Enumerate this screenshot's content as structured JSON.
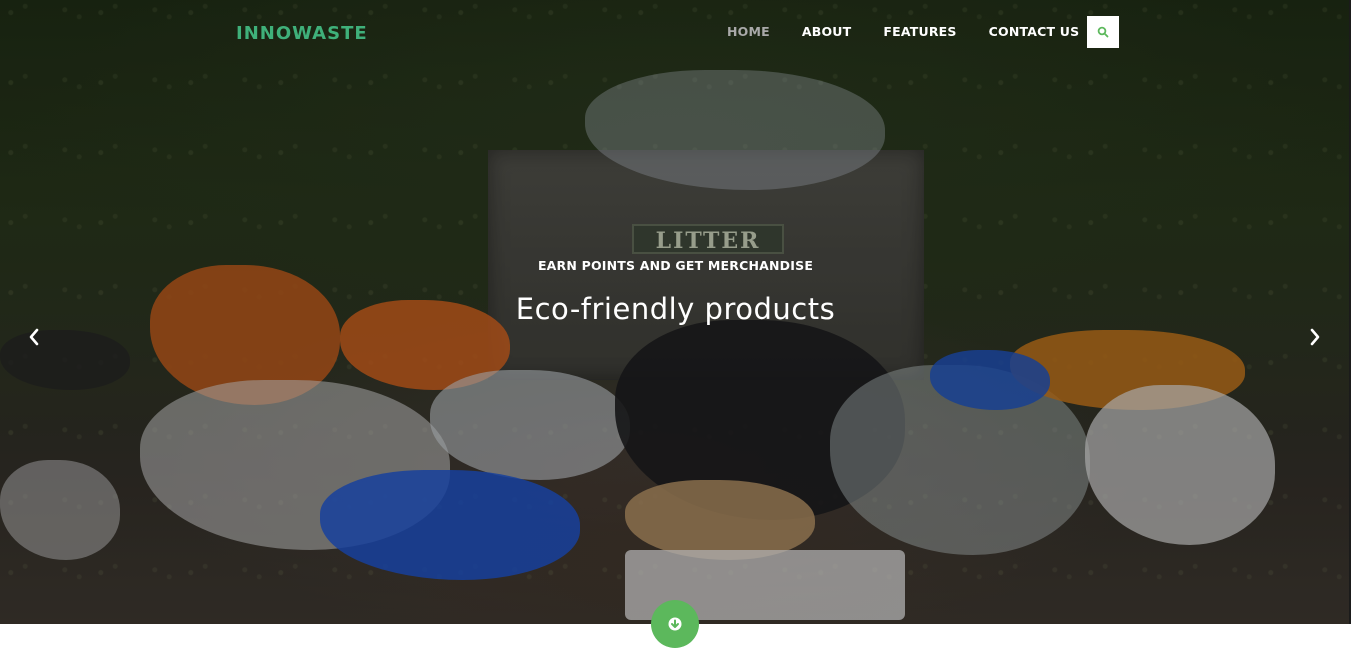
{
  "brand": {
    "logo_text": "INNOWASTE",
    "logo_color": "#3fb07a"
  },
  "nav": {
    "items": [
      {
        "label": "HOME",
        "active": true
      },
      {
        "label": "ABOUT",
        "active": false
      },
      {
        "label": "FEATURES",
        "active": false
      },
      {
        "label": "CONTACT US",
        "active": false
      }
    ],
    "search_icon": "search-icon",
    "search_icon_color": "#5cb85c"
  },
  "hero": {
    "bin_sign": "LITTER",
    "subtitle": "EARN POINTS AND GET MERCHANDISE",
    "headline": "Eco-friendly products",
    "prev_icon": "chevron-left-icon",
    "next_icon": "chevron-right-icon"
  },
  "scroll_button": {
    "icon": "arrow-down-icon",
    "color": "#5cb85c"
  }
}
